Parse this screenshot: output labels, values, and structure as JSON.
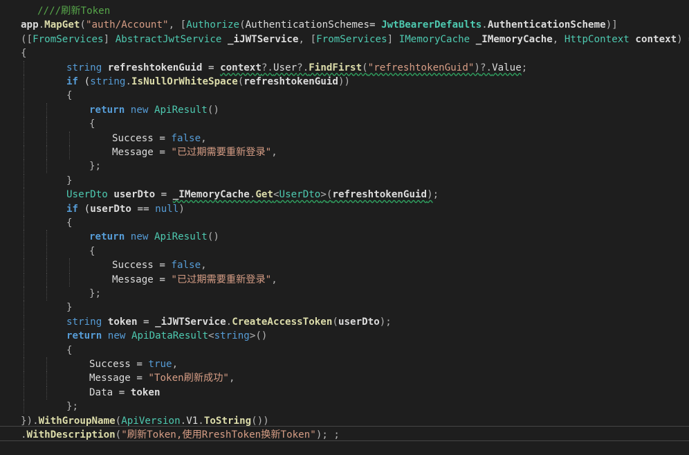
{
  "editor": {
    "theme_colors": {
      "background": "#1e1e1e",
      "comment": "#57a64a",
      "keyword": "#569cd6",
      "type": "#4ec9b0",
      "string": "#d69d85",
      "method": "#dcdcaa",
      "default": "#dcdcdc"
    },
    "lines": [
      {
        "indent": 1,
        "guides": [],
        "segs": [
          [
            "t-comment",
            "////刷新Token"
          ]
        ]
      },
      {
        "indent": 0,
        "guides": [],
        "segs": [
          [
            "t-bold",
            "app"
          ],
          [
            "t-punc",
            "."
          ],
          [
            "t-methodb",
            "MapGet"
          ],
          [
            "t-punc",
            "("
          ],
          [
            "t-string",
            "\"auth/Account\""
          ],
          [
            "t-punc",
            ", ["
          ],
          [
            "t-attr",
            "Authorize"
          ],
          [
            "t-punc",
            "("
          ],
          [
            "t-plain",
            "AuthenticationSchemes= "
          ],
          [
            "t-typeb",
            "JwtBearerDefaults"
          ],
          [
            "t-punc",
            "."
          ],
          [
            "t-bold",
            "AuthenticationScheme"
          ],
          [
            "t-punc",
            ")]"
          ]
        ]
      },
      {
        "indent": 0,
        "guides": [],
        "segs": [
          [
            "t-punc",
            "(["
          ],
          [
            "t-attr",
            "FromServices"
          ],
          [
            "t-punc",
            "] "
          ],
          [
            "t-type",
            "AbstractJwtService"
          ],
          [
            "t-plain",
            " "
          ],
          [
            "t-bold",
            "_iJWTService"
          ],
          [
            "t-punc",
            ", ["
          ],
          [
            "t-attr",
            "FromServices"
          ],
          [
            "t-punc",
            "] "
          ],
          [
            "t-type",
            "IMemoryCache"
          ],
          [
            "t-plain",
            " "
          ],
          [
            "t-bold",
            "_IMemoryCache"
          ],
          [
            "t-punc",
            ", "
          ],
          [
            "t-type",
            "HttpContext"
          ],
          [
            "t-plain",
            " "
          ],
          [
            "t-bold",
            "context"
          ],
          [
            "t-punc",
            ") =>"
          ]
        ]
      },
      {
        "indent": 0,
        "guides": [],
        "segs": [
          [
            "t-punc",
            "{"
          ]
        ]
      },
      {
        "indent": 2,
        "guides": [
          1
        ],
        "segs": [
          [
            "t-kw",
            "string"
          ],
          [
            "t-plain",
            " "
          ],
          [
            "t-bold",
            "refreshtokenGuid"
          ],
          [
            "t-plain",
            " = "
          ],
          [
            "t-bold sq",
            "context"
          ],
          [
            "t-punc sq",
            "?."
          ],
          [
            "t-plain sq",
            "User"
          ],
          [
            "t-punc sq",
            "?."
          ],
          [
            "t-methodb sq",
            "FindFirst"
          ],
          [
            "t-punc sq",
            "("
          ],
          [
            "t-string sq",
            "\"refreshtokenGuid\""
          ],
          [
            "t-punc sq",
            ")"
          ],
          [
            "t-punc sq",
            "?."
          ],
          [
            "t-plain sq",
            "Value"
          ],
          [
            "t-punc",
            ";"
          ]
        ]
      },
      {
        "indent": 2,
        "guides": [
          1
        ],
        "segs": [
          [
            "t-kwb",
            "if"
          ],
          [
            "t-plain",
            " ("
          ],
          [
            "t-kw",
            "string"
          ],
          [
            "t-punc",
            "."
          ],
          [
            "t-methodb",
            "IsNullOrWhiteSpace"
          ],
          [
            "t-punc",
            "("
          ],
          [
            "t-bold",
            "refreshtokenGuid"
          ],
          [
            "t-punc",
            "))"
          ]
        ]
      },
      {
        "indent": 2,
        "guides": [
          1
        ],
        "segs": [
          [
            "t-punc",
            "{"
          ]
        ]
      },
      {
        "indent": 3,
        "guides": [
          1,
          2
        ],
        "segs": [
          [
            "t-kwb",
            "return"
          ],
          [
            "t-plain",
            " "
          ],
          [
            "t-kw",
            "new"
          ],
          [
            "t-plain",
            " "
          ],
          [
            "t-type",
            "ApiResult"
          ],
          [
            "t-punc",
            "()"
          ]
        ]
      },
      {
        "indent": 3,
        "guides": [
          1,
          2
        ],
        "segs": [
          [
            "t-punc",
            "{"
          ]
        ]
      },
      {
        "indent": 4,
        "guides": [
          1,
          2,
          3
        ],
        "segs": [
          [
            "t-plain",
            "Success"
          ],
          [
            "t-plain",
            " = "
          ],
          [
            "t-kw",
            "false"
          ],
          [
            "t-punc",
            ","
          ]
        ]
      },
      {
        "indent": 4,
        "guides": [
          1,
          2,
          3
        ],
        "segs": [
          [
            "t-plain",
            "Message"
          ],
          [
            "t-plain",
            " = "
          ],
          [
            "t-string",
            "\"已过期需要重新登录\""
          ],
          [
            "t-punc",
            ","
          ]
        ]
      },
      {
        "indent": 3,
        "guides": [
          1,
          2
        ],
        "segs": [
          [
            "t-punc",
            "};"
          ]
        ]
      },
      {
        "indent": 2,
        "guides": [
          1
        ],
        "segs": [
          [
            "t-punc",
            "}"
          ]
        ]
      },
      {
        "indent": 2,
        "guides": [
          1
        ],
        "segs": [
          [
            "t-type",
            "UserDto"
          ],
          [
            "t-plain",
            " "
          ],
          [
            "t-bold",
            "userDto"
          ],
          [
            "t-plain",
            " = "
          ],
          [
            "t-bold sq",
            "_IMemoryCache"
          ],
          [
            "t-punc sq",
            "."
          ],
          [
            "t-methodb sq",
            "Get"
          ],
          [
            "t-punc sq",
            "<"
          ],
          [
            "t-type sq",
            "UserDto"
          ],
          [
            "t-punc sq",
            ">"
          ],
          [
            "t-punc sq",
            "("
          ],
          [
            "t-bold sq",
            "refreshtokenGuid"
          ],
          [
            "t-punc sq",
            ")"
          ],
          [
            "t-punc",
            ";"
          ]
        ]
      },
      {
        "indent": 2,
        "guides": [
          1
        ],
        "segs": [
          [
            "t-kwb",
            "if"
          ],
          [
            "t-plain",
            " ("
          ],
          [
            "t-bold",
            "userDto"
          ],
          [
            "t-plain",
            " == "
          ],
          [
            "t-kw",
            "null"
          ],
          [
            "t-punc",
            ")"
          ]
        ]
      },
      {
        "indent": 2,
        "guides": [
          1
        ],
        "segs": [
          [
            "t-punc",
            "{"
          ]
        ]
      },
      {
        "indent": 3,
        "guides": [
          1,
          2
        ],
        "segs": [
          [
            "t-kwb",
            "return"
          ],
          [
            "t-plain",
            " "
          ],
          [
            "t-kw",
            "new"
          ],
          [
            "t-plain",
            " "
          ],
          [
            "t-type",
            "ApiResult"
          ],
          [
            "t-punc",
            "()"
          ]
        ]
      },
      {
        "indent": 3,
        "guides": [
          1,
          2
        ],
        "segs": [
          [
            "t-punc",
            "{"
          ]
        ]
      },
      {
        "indent": 4,
        "guides": [
          1,
          2,
          3
        ],
        "segs": [
          [
            "t-plain",
            "Success"
          ],
          [
            "t-plain",
            " = "
          ],
          [
            "t-kw",
            "false"
          ],
          [
            "t-punc",
            ","
          ]
        ]
      },
      {
        "indent": 4,
        "guides": [
          1,
          2,
          3
        ],
        "segs": [
          [
            "t-plain",
            "Message"
          ],
          [
            "t-plain",
            " = "
          ],
          [
            "t-string",
            "\"已过期需要重新登录\""
          ],
          [
            "t-punc",
            ","
          ]
        ]
      },
      {
        "indent": 3,
        "guides": [
          1,
          2
        ],
        "segs": [
          [
            "t-punc",
            "};"
          ]
        ]
      },
      {
        "indent": 2,
        "guides": [
          1
        ],
        "segs": [
          [
            "t-punc",
            "}"
          ]
        ]
      },
      {
        "indent": 2,
        "guides": [
          1
        ],
        "segs": [
          [
            "t-kw",
            "string"
          ],
          [
            "t-plain",
            " "
          ],
          [
            "t-bold",
            "token"
          ],
          [
            "t-plain",
            " = "
          ],
          [
            "t-bold",
            "_iJWTService"
          ],
          [
            "t-punc",
            "."
          ],
          [
            "t-methodb",
            "CreateAccessToken"
          ],
          [
            "t-punc",
            "("
          ],
          [
            "t-bold",
            "userDto"
          ],
          [
            "t-punc",
            ");"
          ]
        ]
      },
      {
        "indent": 2,
        "guides": [
          1
        ],
        "segs": [
          [
            "t-kwb",
            "return"
          ],
          [
            "t-plain",
            " "
          ],
          [
            "t-kw",
            "new"
          ],
          [
            "t-plain",
            " "
          ],
          [
            "t-type",
            "ApiDataResult"
          ],
          [
            "t-punc",
            "<"
          ],
          [
            "t-kw",
            "string"
          ],
          [
            "t-punc",
            ">()"
          ]
        ]
      },
      {
        "indent": 2,
        "guides": [
          1
        ],
        "segs": [
          [
            "t-punc",
            "{"
          ]
        ]
      },
      {
        "indent": 3,
        "guides": [
          1,
          2
        ],
        "segs": [
          [
            "t-plain",
            "Success"
          ],
          [
            "t-plain",
            " = "
          ],
          [
            "t-kw",
            "true"
          ],
          [
            "t-punc",
            ","
          ]
        ]
      },
      {
        "indent": 3,
        "guides": [
          1,
          2
        ],
        "segs": [
          [
            "t-plain",
            "Message"
          ],
          [
            "t-plain",
            " = "
          ],
          [
            "t-string",
            "\"Token刷新成功\""
          ],
          [
            "t-punc",
            ","
          ]
        ]
      },
      {
        "indent": 3,
        "guides": [
          1,
          2
        ],
        "segs": [
          [
            "t-plain",
            "Data"
          ],
          [
            "t-plain",
            " = "
          ],
          [
            "t-bold",
            "token"
          ]
        ]
      },
      {
        "indent": 2,
        "guides": [
          1
        ],
        "segs": [
          [
            "t-punc",
            "};"
          ]
        ]
      },
      {
        "indent": 0,
        "guides": [],
        "segs": [
          [
            "t-punc",
            "})."
          ],
          [
            "t-methodb",
            "WithGroupName"
          ],
          [
            "t-punc",
            "("
          ],
          [
            "t-type",
            "ApiVersion"
          ],
          [
            "t-punc",
            "."
          ],
          [
            "t-plain",
            "V1"
          ],
          [
            "t-punc",
            "."
          ],
          [
            "t-methodb",
            "ToString"
          ],
          [
            "t-punc",
            "())"
          ]
        ]
      },
      {
        "indent": 0,
        "guides": [],
        "segs": [
          [
            "t-punc",
            "."
          ],
          [
            "t-methodb",
            "WithDescription"
          ],
          [
            "t-punc",
            "("
          ],
          [
            "t-string",
            "\"刷新Token,使用RreshToken换新Token\""
          ],
          [
            "t-punc",
            "); ;"
          ]
        ]
      }
    ]
  }
}
